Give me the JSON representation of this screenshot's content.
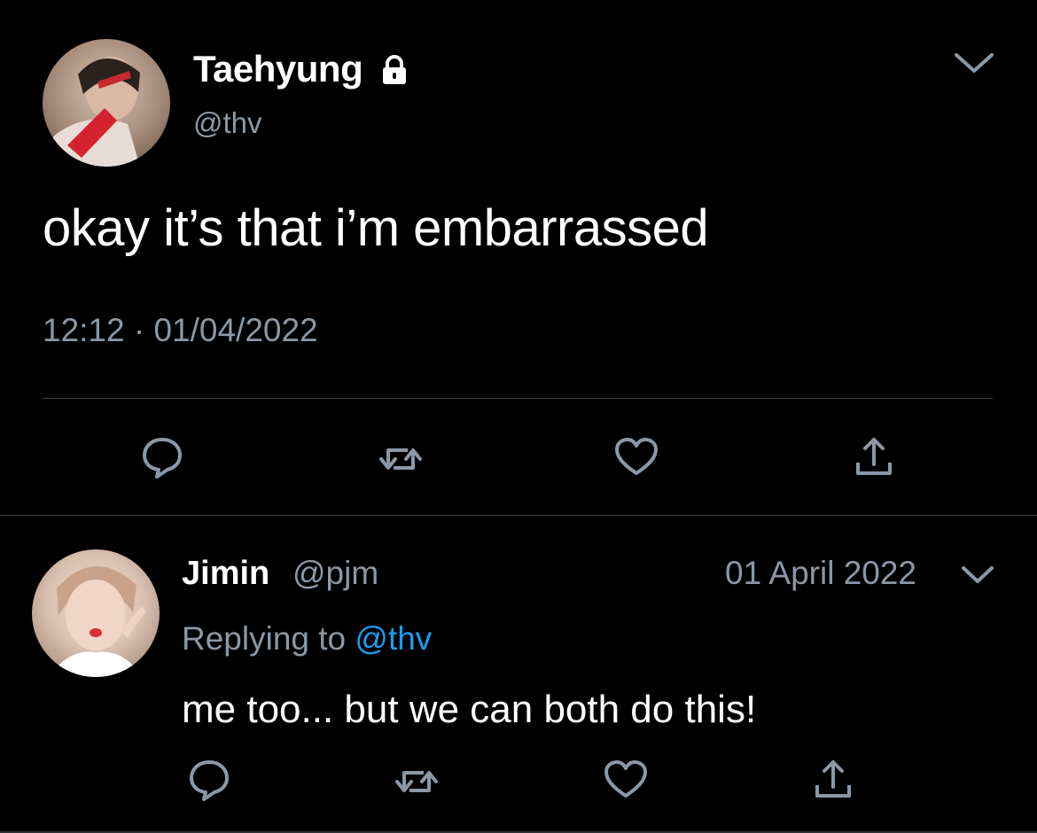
{
  "tweet": {
    "author_name": "Taehyung",
    "author_handle": "@thv",
    "text": "okay it’s that i’m embarrassed",
    "timestamp": "12:12 · 01/04/2022",
    "icons": [
      "lock-icon",
      "chevron-down-icon",
      "reply-icon",
      "retweet-icon",
      "like-icon",
      "share-icon"
    ]
  },
  "reply": {
    "author_name": "Jimin",
    "author_handle": "@pjm",
    "date": "01 April 2022",
    "replying_prefix": "Replying to ",
    "replying_to": "@thv",
    "text": "me too... but we can both do this!",
    "icons": [
      "chevron-down-icon",
      "reply-icon",
      "retweet-icon",
      "like-icon",
      "share-icon"
    ]
  },
  "colors": {
    "background": "#000000",
    "secondary_text": "#8b98a5",
    "mention": "#1d9bf0",
    "divider": "#38444d"
  }
}
